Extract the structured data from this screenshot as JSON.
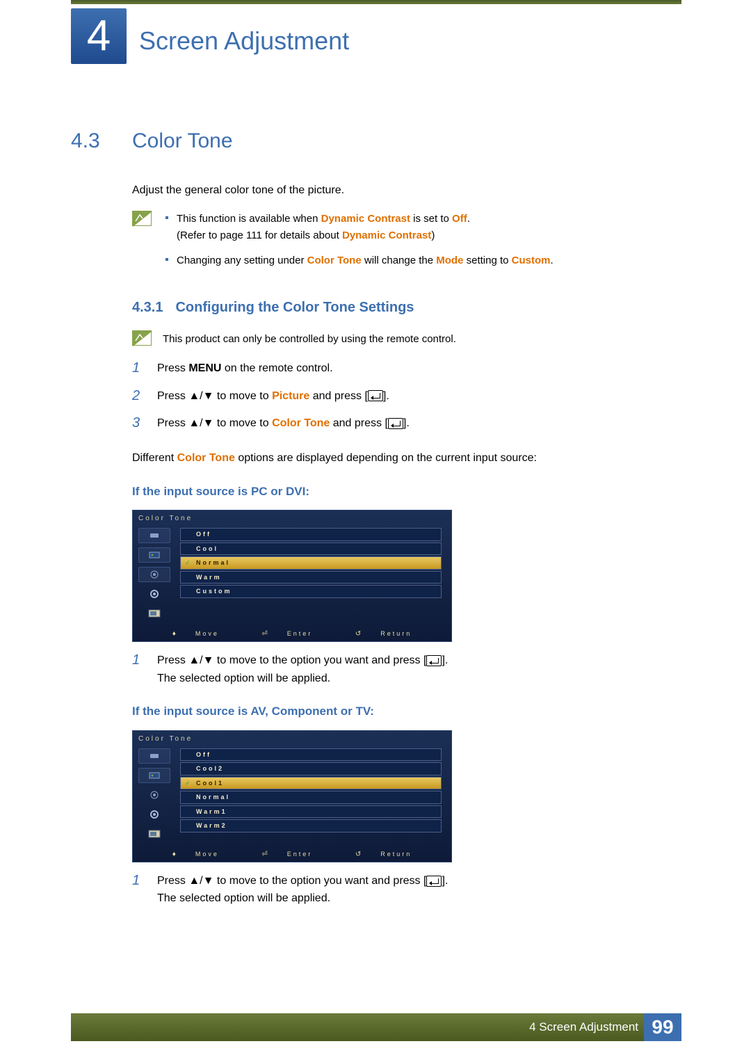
{
  "chapter": {
    "number": "4",
    "title": "Screen Adjustment"
  },
  "section": {
    "number": "4.3",
    "title": "Color Tone"
  },
  "intro": "Adjust the general color tone of the picture.",
  "notes": {
    "li1_a": "This function is available when ",
    "li1_b": "Dynamic Contrast",
    "li1_c": " is set to ",
    "li1_d": "Off",
    "li1_e": ".",
    "li1_f": "(Refer to page 111 for details about ",
    "li1_g": "Dynamic Contrast",
    "li1_h": ")",
    "li2_a": "Changing any setting under ",
    "li2_b": "Color Tone",
    "li2_c": " will change the ",
    "li2_d": "Mode",
    "li2_e": " setting to ",
    "li2_f": "Custom",
    "li2_g": "."
  },
  "subsection": {
    "number": "4.3.1",
    "title": "Configuring the Color Tone Settings"
  },
  "info": "This product can only be controlled by using the remote control.",
  "steps": {
    "s1_a": "Press ",
    "s1_b": "MENU",
    "s1_c": " on the remote control.",
    "s2_a": "Press ",
    "s2_b": " to move to ",
    "s2_c": "Picture",
    "s2_d": " and press [",
    "s2_e": "].",
    "s3_a": "Press ",
    "s3_b": " to move to ",
    "s3_c": "Color Tone",
    "s3_d": " and press [",
    "s3_e": "]."
  },
  "para2_a": "Different ",
  "para2_b": "Color Tone",
  "para2_c": " options are displayed depending on the current input source:",
  "heading_pc": "If the input source is PC or DVI:",
  "osd1": {
    "title": "Color Tone",
    "options": [
      "Off",
      "Cool",
      "Normal",
      "Warm",
      "Custom"
    ],
    "selectedIndex": 2,
    "footer": {
      "move": "Move",
      "enter": "Enter",
      "return": "Return"
    }
  },
  "sub_pc": {
    "a": "Press ",
    "b": " to move to the option you want and press [",
    "c": "].",
    "d": "The selected option will be applied."
  },
  "heading_av": "If the input source is AV, Component or TV:",
  "osd2": {
    "title": "Color Tone",
    "options": [
      "Off",
      "Cool2",
      "Cool1",
      "Normal",
      "Warm1",
      "Warm2"
    ],
    "selectedIndex": 2,
    "footer": {
      "move": "Move",
      "enter": "Enter",
      "return": "Return"
    }
  },
  "sub_av": {
    "a": "Press ",
    "b": " to move to the option you want and press [",
    "c": "].",
    "d": "The selected option will be applied."
  },
  "footer": {
    "label": "4 Screen Adjustment",
    "page": "99"
  }
}
